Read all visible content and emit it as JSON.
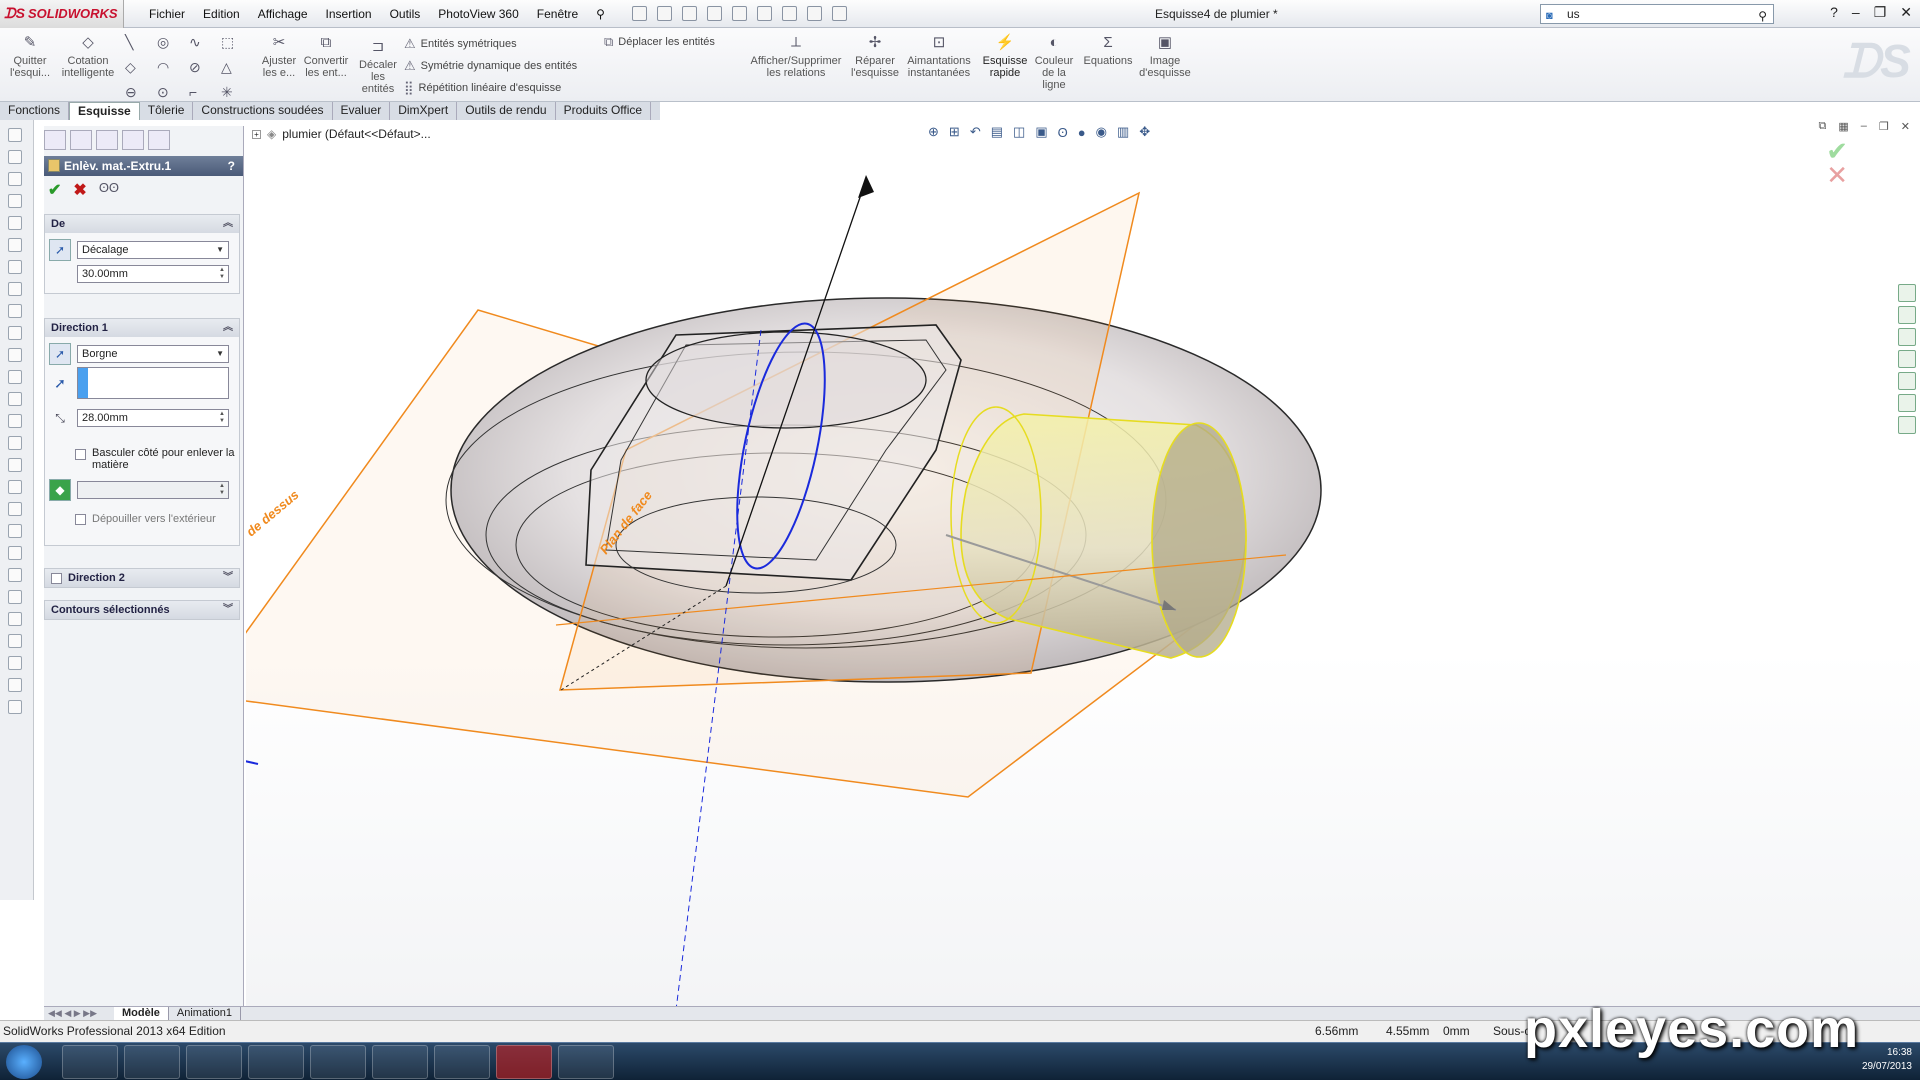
{
  "app": {
    "brand": "SOLIDWORKS",
    "document_title": "Esquisse4 de plumier *",
    "search_value": "us"
  },
  "menu": [
    "Fichier",
    "Edition",
    "Affichage",
    "Insertion",
    "Outils",
    "PhotoView 360",
    "Fenêtre"
  ],
  "ribbon": {
    "quit_sketch": "Quitter l'esqui...",
    "smart_dim": "Cotation intelligente",
    "trim": "Ajuster les e...",
    "convert": "Convertir les ent...",
    "offset": "Décaler les entités",
    "mirror": "Entités symétriques",
    "dyn_mirror": "Symétrie dynamique des entités",
    "linear_pattern": "Répétition linéaire d'esquisse",
    "move": "Déplacer les entités",
    "relations": "Afficher/Supprimer les relations",
    "repair": "Réparer l'esquisse",
    "snaps": "Aimantations instantanées",
    "rapid_sketch": "Esquisse rapide",
    "line_color": "Couleur de la ligne",
    "equations": "Equations",
    "sketch_picture": "Image d'esquisse"
  },
  "tabs": [
    "Fonctions",
    "Esquisse",
    "Tôlerie",
    "Constructions soudées",
    "Evaluer",
    "DimXpert",
    "Outils de rendu",
    "Produits Office"
  ],
  "active_tab": "Esquisse",
  "property_manager": {
    "title": "Enlèv. mat.-Extru.1",
    "help": "?",
    "from": {
      "label": "De",
      "type": "Décalage",
      "value": "30.00mm"
    },
    "direction1": {
      "label": "Direction 1",
      "end_condition": "Borgne",
      "depth": "28.00mm",
      "flip_side_label": "Basculer côté pour enlever la matière",
      "draft_outward_label": "Dépouiller vers l'extérieur"
    },
    "direction2": {
      "label": "Direction 2"
    },
    "selected_contours": {
      "label": "Contours sélectionnés"
    }
  },
  "graphics": {
    "tree_item": "plumier  (Défaut<<Défaut>...",
    "plane_front": "Plan de face",
    "plane_top": "de dessus"
  },
  "bottom_tabs": [
    "Modèle",
    "Animation1"
  ],
  "status": {
    "version": "SolidWorks Professional 2013 x64 Edition",
    "x": "6.56mm",
    "y": "4.55mm",
    "z": "0mm",
    "state": "Sous-c"
  },
  "taskbar": {
    "time": "16:38",
    "date": "29/07/2013"
  },
  "watermark": "pxleyes.com",
  "colors": {
    "accent": "#c8102e",
    "plane_orange": "#f08a1e",
    "sketch_blue": "#1a2adc",
    "cylinder_yellow": "#f2ee7a"
  }
}
